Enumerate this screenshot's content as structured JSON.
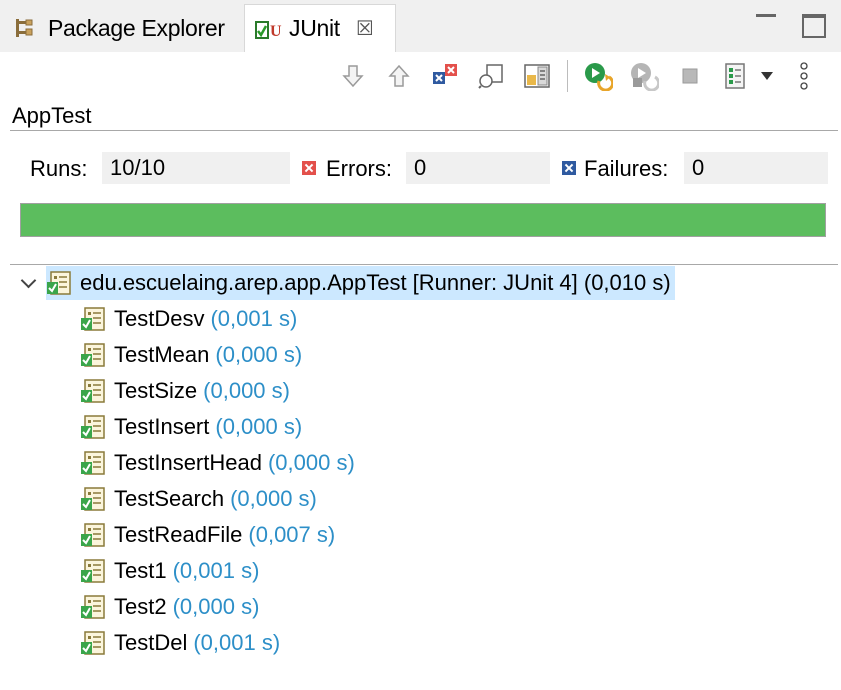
{
  "tabs": {
    "package_explorer": "Package Explorer",
    "junit": "JUnit",
    "close_glyph": "☒"
  },
  "toolbar": {
    "icons": [
      "next-failure-icon",
      "previous-failure-icon",
      "show-failures-only-icon",
      "scroll-lock-icon",
      "layout-icon",
      "rerun-test-icon",
      "rerun-failed-first-icon",
      "stop-icon",
      "test-run-history-icon",
      "dropdown-arrow-icon",
      "view-menu-icon"
    ]
  },
  "view": {
    "title": "AppTest"
  },
  "counters": {
    "runs_label": "Runs:",
    "runs_value": "10/10",
    "errors_label": "Errors:",
    "errors_value": "0",
    "failures_label": "Failures:",
    "failures_value": "0"
  },
  "progress": {
    "fraction": 1.0,
    "color": "#5cbd5e"
  },
  "tree": {
    "root": "edu.escuelaing.arep.app.AppTest [Runner: JUnit 4] (0,010 s)",
    "tests": [
      {
        "name": "TestDesv",
        "time": "(0,001 s)"
      },
      {
        "name": "TestMean",
        "time": "(0,000 s)"
      },
      {
        "name": "TestSize",
        "time": "(0,000 s)"
      },
      {
        "name": "TestInsert",
        "time": "(0,000 s)"
      },
      {
        "name": "TestInsertHead",
        "time": "(0,000 s)"
      },
      {
        "name": "TestSearch",
        "time": "(0,000 s)"
      },
      {
        "name": "TestReadFile",
        "time": "(0,007 s)"
      },
      {
        "name": "Test1",
        "time": "(0,001 s)"
      },
      {
        "name": "Test2",
        "time": "(0,000 s)"
      },
      {
        "name": "TestDel",
        "time": "(0,001 s)"
      }
    ]
  },
  "colors": {
    "selection": "#cce8ff",
    "time_text": "#2d8fc8",
    "error": "#e3504b",
    "failure": "#2f5aa0"
  }
}
